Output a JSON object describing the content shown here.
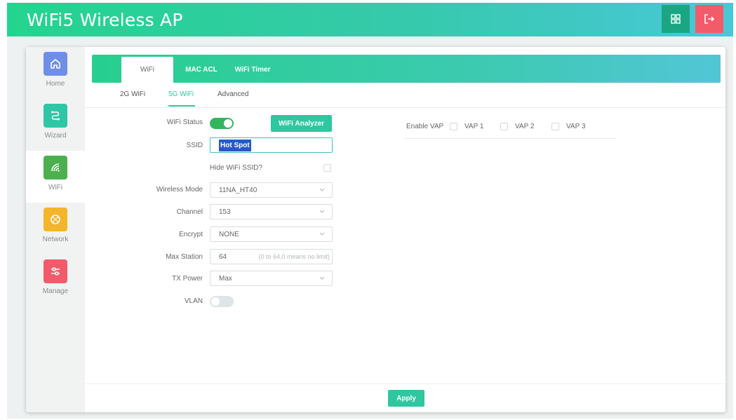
{
  "app": {
    "title": "WiFi5 Wireless AP"
  },
  "topbar": {
    "grid_icon": "grid-icon",
    "logout_icon": "logout-icon",
    "grid_color": "#1aa683",
    "logout_color": "#f25b6a"
  },
  "sidebar": {
    "items": [
      {
        "label": "Home",
        "icon": "home-icon",
        "color": "#6e8fe6",
        "active": false
      },
      {
        "label": "Wizard",
        "icon": "wizard-icon",
        "color": "#2fc6a6",
        "active": false
      },
      {
        "label": "WiFi",
        "icon": "wifi-icon",
        "color": "#4caf50",
        "active": true
      },
      {
        "label": "Network",
        "icon": "network-icon",
        "color": "#f3b52a",
        "active": false
      },
      {
        "label": "Manage",
        "icon": "manage-icon",
        "color": "#f25b6a",
        "active": false
      }
    ]
  },
  "tabs": [
    {
      "label": "WiFi",
      "active": true
    },
    {
      "label": "MAC ACL",
      "active": false
    },
    {
      "label": "WiFi Timer",
      "active": false
    }
  ],
  "subtabs": [
    {
      "label": "2G WiFi",
      "active": false
    },
    {
      "label": "5G WiFi",
      "active": true
    },
    {
      "label": "Advanced",
      "active": false
    }
  ],
  "form": {
    "wifi_status": {
      "label": "WiFi Status",
      "on": true
    },
    "analyzer_label": "WiFi Analyzer",
    "ssid": {
      "label": "SSID",
      "value": "Hot Spot"
    },
    "hide_ssid": {
      "label": "Hide WiFi SSID?",
      "checked": false
    },
    "wireless_mode": {
      "label": "Wireless Mode",
      "value": "11NA_HT40"
    },
    "channel": {
      "label": "Channel",
      "value": "153"
    },
    "encrypt": {
      "label": "Encrypt",
      "value": "NONE"
    },
    "max_station": {
      "label": "Max Station",
      "value": "64",
      "hint": "(0 to 64,0 means no limit)"
    },
    "tx_power": {
      "label": "TX Power",
      "value": "Max"
    },
    "vlan": {
      "label": "VLAN",
      "on": false
    }
  },
  "vap": {
    "label": "Enable VAP",
    "items": [
      {
        "label": "VAP 1",
        "checked": false
      },
      {
        "label": "VAP 2",
        "checked": false
      },
      {
        "label": "VAP 3",
        "checked": false
      }
    ]
  },
  "apply_label": "Apply",
  "colors": {
    "accent": "#2ec7a0",
    "toggle_on": "#34b55d"
  }
}
